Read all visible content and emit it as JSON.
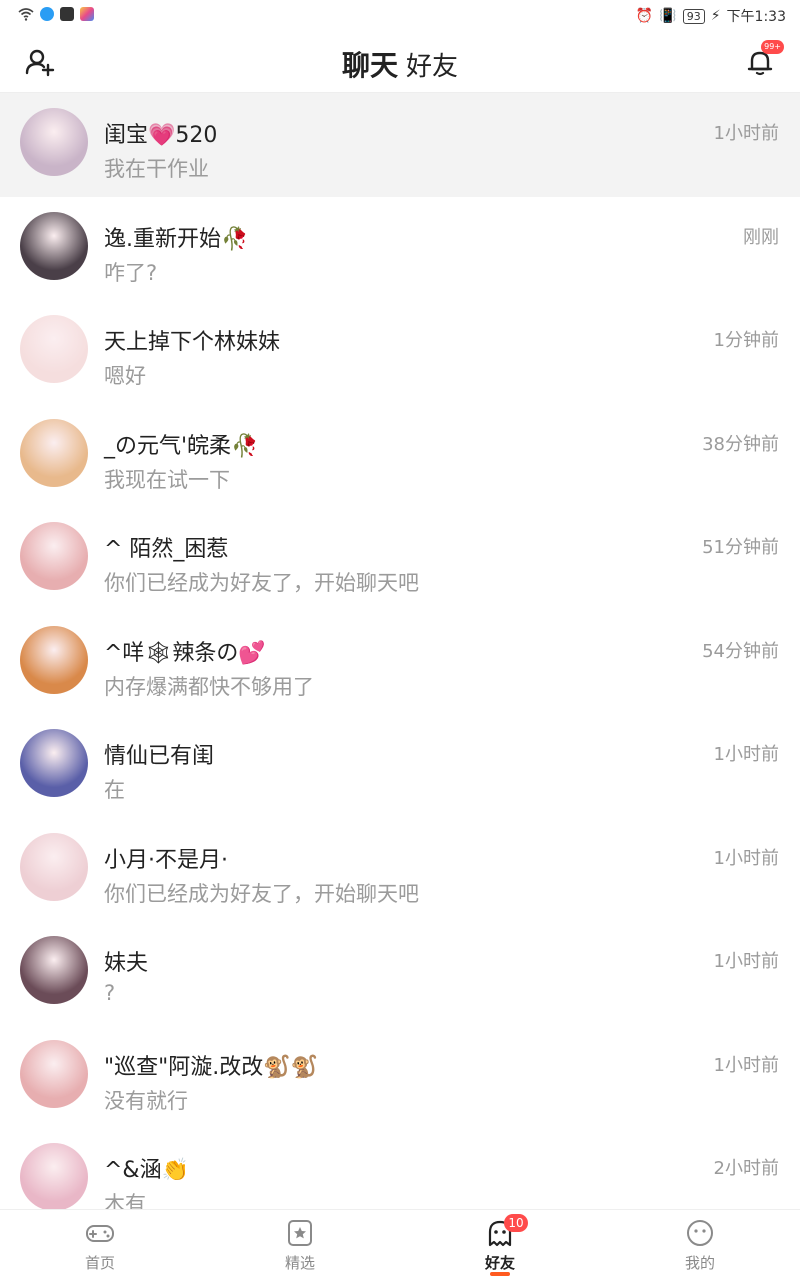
{
  "status_bar": {
    "battery": "93",
    "time": "下午1:33"
  },
  "header": {
    "tabs": [
      {
        "label": "聊天",
        "active": true
      },
      {
        "label": "好友",
        "active": false
      }
    ],
    "notification_badge": "99+"
  },
  "chats": [
    {
      "name": "闺宝💗520",
      "message": "我在干作业",
      "time": "1小时前",
      "highlight": true,
      "avatar_color": "#c9b4c8"
    },
    {
      "name": "逸.重新开始🥀",
      "message": "咋了?",
      "time": "刚刚",
      "avatar_color": "#4a3f48"
    },
    {
      "name": "天上掉下个林妹妹",
      "message": "嗯好",
      "time": "1分钟前",
      "avatar_color": "#f5dede"
    },
    {
      "name": "_の元气'皖柔🥀",
      "message": "我现在试一下",
      "time": "38分钟前",
      "avatar_color": "#e8b98c"
    },
    {
      "name": "^ 陌然_困惹",
      "message": "你们已经成为好友了，开始聊天吧",
      "time": "51分钟前",
      "avatar_color": "#e7aeb0"
    },
    {
      "name": "^咩🕸辣条の💕",
      "message": "内存爆满都快不够用了",
      "time": "54分钟前",
      "avatar_color": "#d9894a"
    },
    {
      "name": "情仙已有闺",
      "message": "在",
      "time": "1小时前",
      "avatar_color": "#5a5fa8"
    },
    {
      "name": "小月·不是月·",
      "message": "你们已经成为好友了，开始聊天吧",
      "time": "1小时前",
      "avatar_color": "#eecfd4"
    },
    {
      "name": "妹夫",
      "message": "?",
      "time": "1小时前",
      "avatar_color": "#6b4c58"
    },
    {
      "name": "\"巡查\"阿漩.改改🐒🐒",
      "message": "没有就行",
      "time": "1小时前",
      "avatar_color": "#e7aeb0"
    },
    {
      "name": "^&涵👏",
      "message": "木有",
      "time": "2小时前",
      "avatar_color": "#e9b7c7"
    }
  ],
  "bottom_nav": {
    "items": [
      {
        "label": "首页",
        "icon": "gamepad-icon"
      },
      {
        "label": "精选",
        "icon": "star-icon"
      },
      {
        "label": "好友",
        "icon": "ghost-icon",
        "badge": "10",
        "active": true
      },
      {
        "label": "我的",
        "icon": "face-icon"
      }
    ]
  },
  "colors": {
    "accent": "#ff5a1f",
    "badge": "#ff4b4b",
    "muted_text": "#9b9b9b"
  }
}
